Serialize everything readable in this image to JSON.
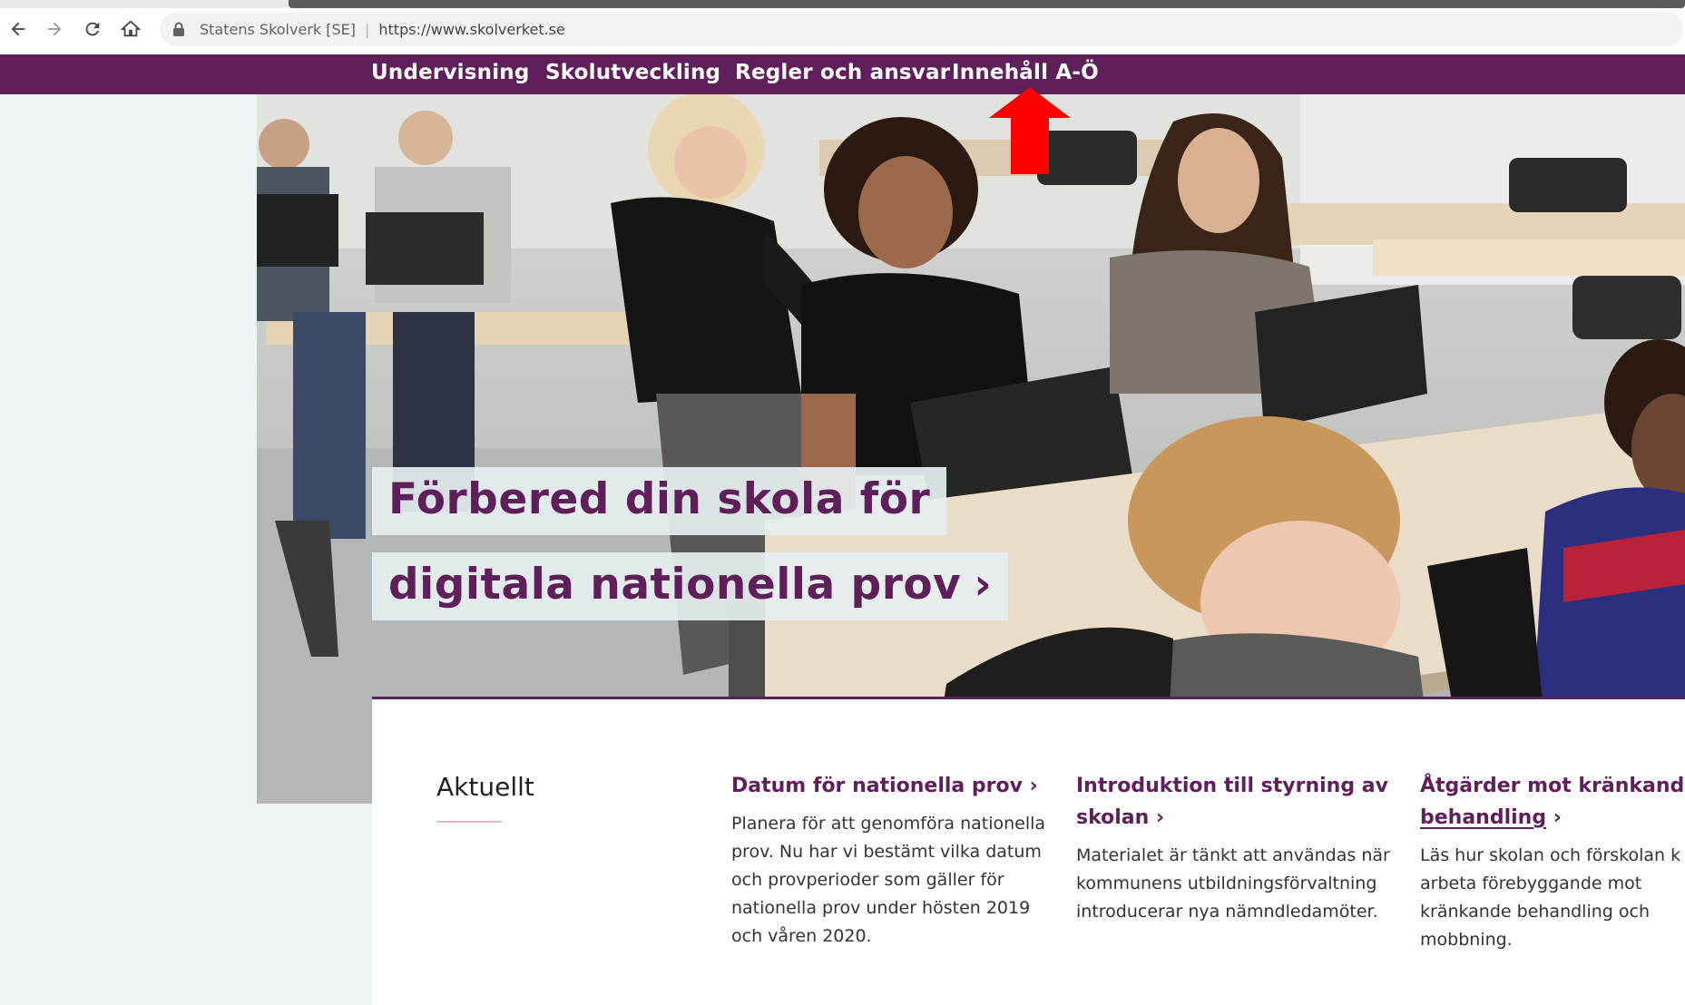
{
  "browser": {
    "site_name": "Statens Skolverk [SE]",
    "url": "https://www.skolverket.se",
    "nav_icons": [
      "back-icon",
      "forward-icon",
      "reload-icon",
      "home-icon",
      "lock-icon"
    ]
  },
  "site_nav": {
    "items": [
      {
        "label": "Undervisning"
      },
      {
        "label": "Skolutveckling"
      },
      {
        "label": "Regler och ansvar"
      },
      {
        "label": "Innehåll A-Ö"
      }
    ],
    "background": "#5f1f5b"
  },
  "hero": {
    "title_line1": "Förbered din skola för",
    "title_line2": "digitala nationella prov",
    "chevron": "›"
  },
  "news": {
    "heading": "Aktuellt",
    "items": [
      {
        "title": "Datum för nationella prov",
        "chevron": "›",
        "body": "Planera för att genomföra nationella prov. Nu har vi bestämt vilka datum och provperioder som gäller för nationella prov under hösten 2019 och våren 2020."
      },
      {
        "title": "Introduktion till styrning av skolan",
        "chevron": "›",
        "body": "Materialet är tänkt att användas när kommunens utbildningsförvaltning introducerar nya nämndledamöter."
      },
      {
        "title_line1": "Åtgärder mot kränkande",
        "title_line2": "behandling",
        "chevron": "›",
        "body_lines": [
          "Läs hur skolan och förskolan k",
          "arbeta förebyggande mot",
          "kränkande behandling och",
          "mobbning."
        ]
      }
    ]
  },
  "colors": {
    "brand_purple": "#5f1f5b",
    "annotation_arrow": "#ff0000",
    "panel_bg": "#eef3f4"
  }
}
